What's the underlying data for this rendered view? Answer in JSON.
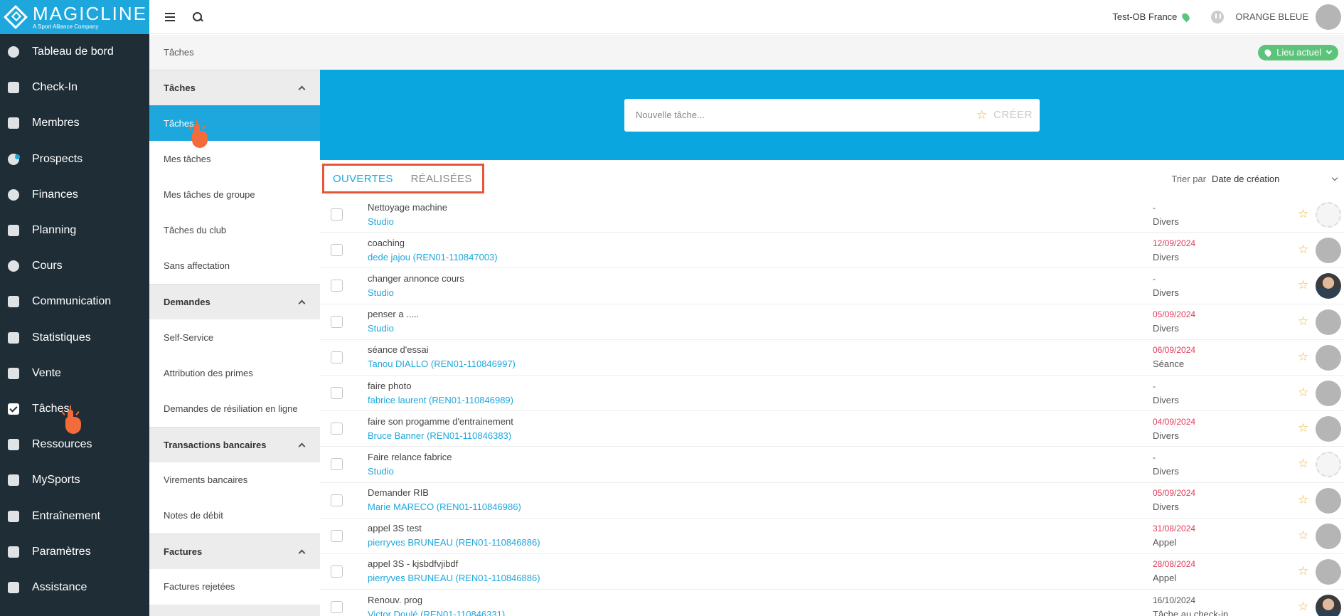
{
  "brand": {
    "title": "MAGICLINE",
    "subtitle": "A Sport Alliance Company"
  },
  "sidebar": {
    "items": [
      {
        "label": "Tableau de bord",
        "icon": "dashboard-icon"
      },
      {
        "label": "Check-In",
        "icon": "check-in-icon"
      },
      {
        "label": "Membres",
        "icon": "members-icon"
      },
      {
        "label": "Prospects",
        "icon": "prospects-icon"
      },
      {
        "label": "Finances",
        "icon": "euro-icon"
      },
      {
        "label": "Planning",
        "icon": "calendar-icon"
      },
      {
        "label": "Cours",
        "icon": "timer-icon"
      },
      {
        "label": "Communication",
        "icon": "chat-icon"
      },
      {
        "label": "Statistiques",
        "icon": "chart-icon"
      },
      {
        "label": "Vente",
        "icon": "cart-icon"
      },
      {
        "label": "Tâches",
        "icon": "checkbox-icon"
      },
      {
        "label": "Ressources",
        "icon": "group-icon"
      },
      {
        "label": "MySports",
        "icon": "grid-icon"
      },
      {
        "label": "Entraînement",
        "icon": "dumbbell-icon"
      },
      {
        "label": "Paramètres",
        "icon": "sliders-icon"
      },
      {
        "label": "Assistance",
        "icon": "help-icon"
      }
    ]
  },
  "topbar": {
    "location": "Test-OB France",
    "org": "ORANGE BLEUE"
  },
  "breadcrumb": {
    "current": "Tâches",
    "location_button": "Lieu actuel"
  },
  "submenu": {
    "groups": [
      {
        "title": "Tâches",
        "items": [
          "Tâches",
          "Mes tâches",
          "Mes tâches de groupe",
          "Tâches du club",
          "Sans affectation"
        ]
      },
      {
        "title": "Demandes",
        "items": [
          "Self-Service",
          "Attribution des primes",
          "Demandes de résiliation en ligne"
        ]
      },
      {
        "title": "Transactions bancaires",
        "items": [
          "Virements bancaires",
          "Notes de débit"
        ]
      },
      {
        "title": "Factures",
        "items": [
          "Factures rejetées"
        ]
      }
    ]
  },
  "new_task": {
    "placeholder": "Nouvelle tâche...",
    "create_label": "CRÉER"
  },
  "tabs": {
    "open": "OUVERTES",
    "done": "RÉALISÉES"
  },
  "sort": {
    "label": "Trier par",
    "value": "Date de création"
  },
  "tasks": [
    {
      "title": "Nettoyage machine",
      "link": "Studio",
      "date": "-",
      "overdue": false,
      "category": "Divers",
      "avatar": "empty"
    },
    {
      "title": "coaching",
      "link": "dede jajou (REN01-110847003)",
      "date": "12/09/2024",
      "overdue": true,
      "category": "Divers",
      "avatar": "default"
    },
    {
      "title": "changer annonce cours",
      "link": "Studio",
      "date": "-",
      "overdue": false,
      "category": "Divers",
      "avatar": "photo"
    },
    {
      "title": "penser a .....",
      "link": "Studio",
      "date": "05/09/2024",
      "overdue": true,
      "category": "Divers",
      "avatar": "default"
    },
    {
      "title": "séance d'essai",
      "link": "Tanou DIALLO (REN01-110846997)",
      "date": "06/09/2024",
      "overdue": true,
      "category": "Séance",
      "avatar": "default"
    },
    {
      "title": "faire photo",
      "link": "fabrice laurent (REN01-110846989)",
      "date": "-",
      "overdue": false,
      "category": "Divers",
      "avatar": "default"
    },
    {
      "title": "faire son progamme d'entrainement",
      "link": "Bruce Banner (REN01-110846383)",
      "date": "04/09/2024",
      "overdue": true,
      "category": "Divers",
      "avatar": "default"
    },
    {
      "title": "Faire relance fabrice",
      "link": "Studio",
      "date": "-",
      "overdue": false,
      "category": "Divers",
      "avatar": "empty"
    },
    {
      "title": "Demander RIB",
      "link": "Marie MARECO (REN01-110846986)",
      "date": "05/09/2024",
      "overdue": true,
      "category": "Divers",
      "avatar": "default"
    },
    {
      "title": "appel 3S test",
      "link": "pierryves BRUNEAU (REN01-110846886)",
      "date": "31/08/2024",
      "overdue": true,
      "category": "Appel",
      "avatar": "default"
    },
    {
      "title": "appel 3S - kjsbdfvjibdf",
      "link": "pierryves BRUNEAU (REN01-110846886)",
      "date": "28/08/2024",
      "overdue": true,
      "category": "Appel",
      "avatar": "default"
    },
    {
      "title": "Renouv. prog",
      "link": "Victor Doulé (REN01-110846331)",
      "date": "16/10/2024",
      "overdue": false,
      "category": "Tâche au check-in",
      "avatar": "photo"
    }
  ],
  "colors": {
    "sidebar_bg": "#1f2d36",
    "accent": "#1ea7dc",
    "hero": "#0aa6df",
    "location_pill": "#5cc47a",
    "overdue": "#e03b5a",
    "highlight_box": "#e8563a"
  }
}
